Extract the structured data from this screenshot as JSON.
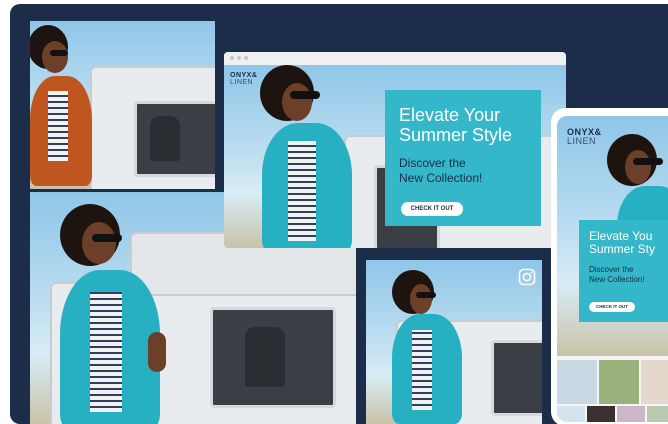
{
  "brand": {
    "name_line1": "ONYX&",
    "name_line2": "LINEN"
  },
  "promo": {
    "headline_line1": "Elevate Your",
    "headline_line2": "Summer Style",
    "sub_line1": "Discover the",
    "sub_line2": "New Collection!",
    "cta": "CHECK IT OUT"
  },
  "phone_promo": {
    "headline_line1": "Elevate You",
    "headline_line2": "Summer Sty",
    "sub_line1": "Discover the",
    "sub_line2": "New Collection!",
    "cta": "CHECK IT OUT"
  },
  "icons": {
    "instagram": "instagram-icon"
  },
  "colors": {
    "background": "#1b2d49",
    "accent": "#34b7c9",
    "shirt": "#27b0c2"
  }
}
